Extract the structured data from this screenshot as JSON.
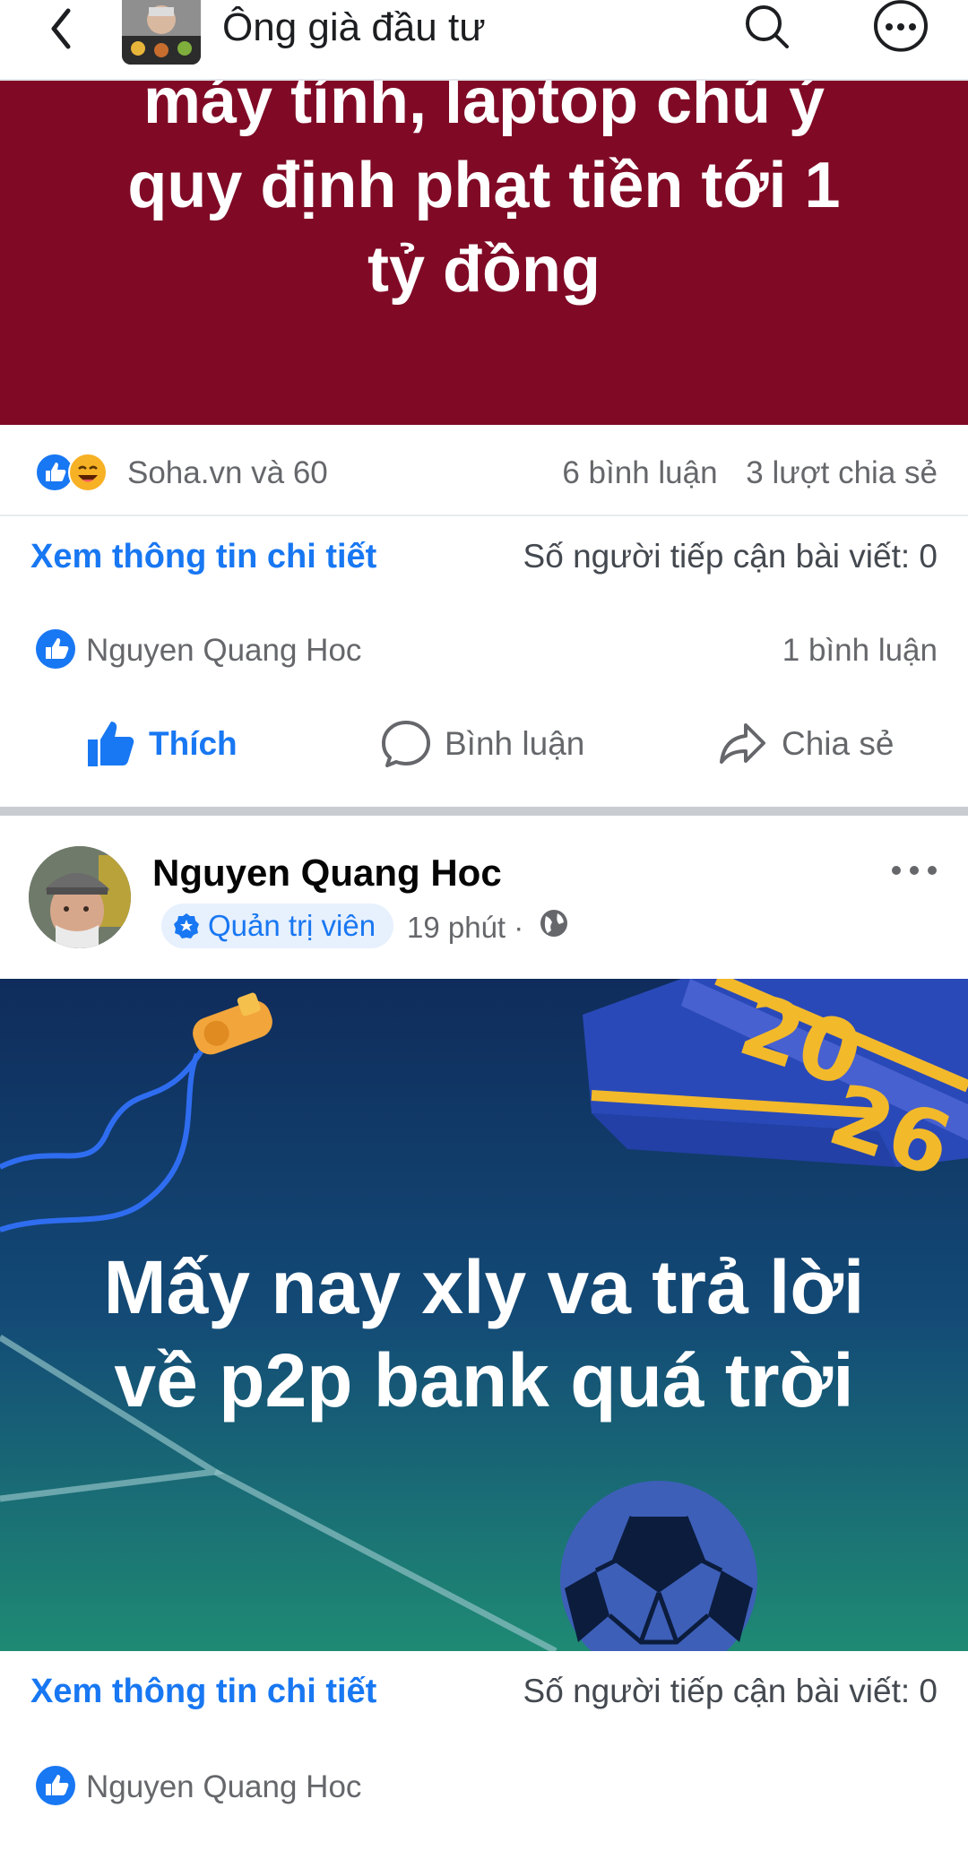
{
  "header": {
    "group_name": "Ông già đầu tư",
    "back_icon": "back-arrow-icon",
    "search_icon": "search-icon",
    "more_icon": "more-options-icon"
  },
  "post1": {
    "image_text_lines": [
      "máy tính, laptop chú ý",
      "quy định phạt tiền tới 1",
      "tỷ đồng"
    ],
    "image_background": "#800a26",
    "reactions_label": "Soha.vn và 60",
    "comments_count": "6 bình luận",
    "shares_count": "3 lượt chia sẻ",
    "insights_link": "Xem thông tin chi tiết",
    "reach_text": "Số người tiếp cận bài viết: 0",
    "liker_name": "Nguyen Quang Hoc",
    "liker_comments": "1 bình luận",
    "actions": {
      "like": "Thích",
      "comment": "Bình luận",
      "share": "Chia sẻ"
    }
  },
  "post2": {
    "author_name": "Nguyen Quang Hoc",
    "badge": "Quản trị viên",
    "time": "19 phút ·",
    "image_text_lines": [
      "Mấy nay xly va trả lời",
      "về p2p bank quá trời"
    ],
    "image_year_top": "20",
    "image_year_bottom": "26",
    "insights_link": "Xem thông tin chi tiết",
    "reach_text": "Số người tiếp cận bài viết: 0",
    "liker_name": "Nguyen Quang Hoc"
  },
  "colors": {
    "accent": "#1877f2",
    "secondary_text": "#65676b",
    "gradient_top": "#12345f",
    "gradient_bottom": "#1f8a74"
  }
}
